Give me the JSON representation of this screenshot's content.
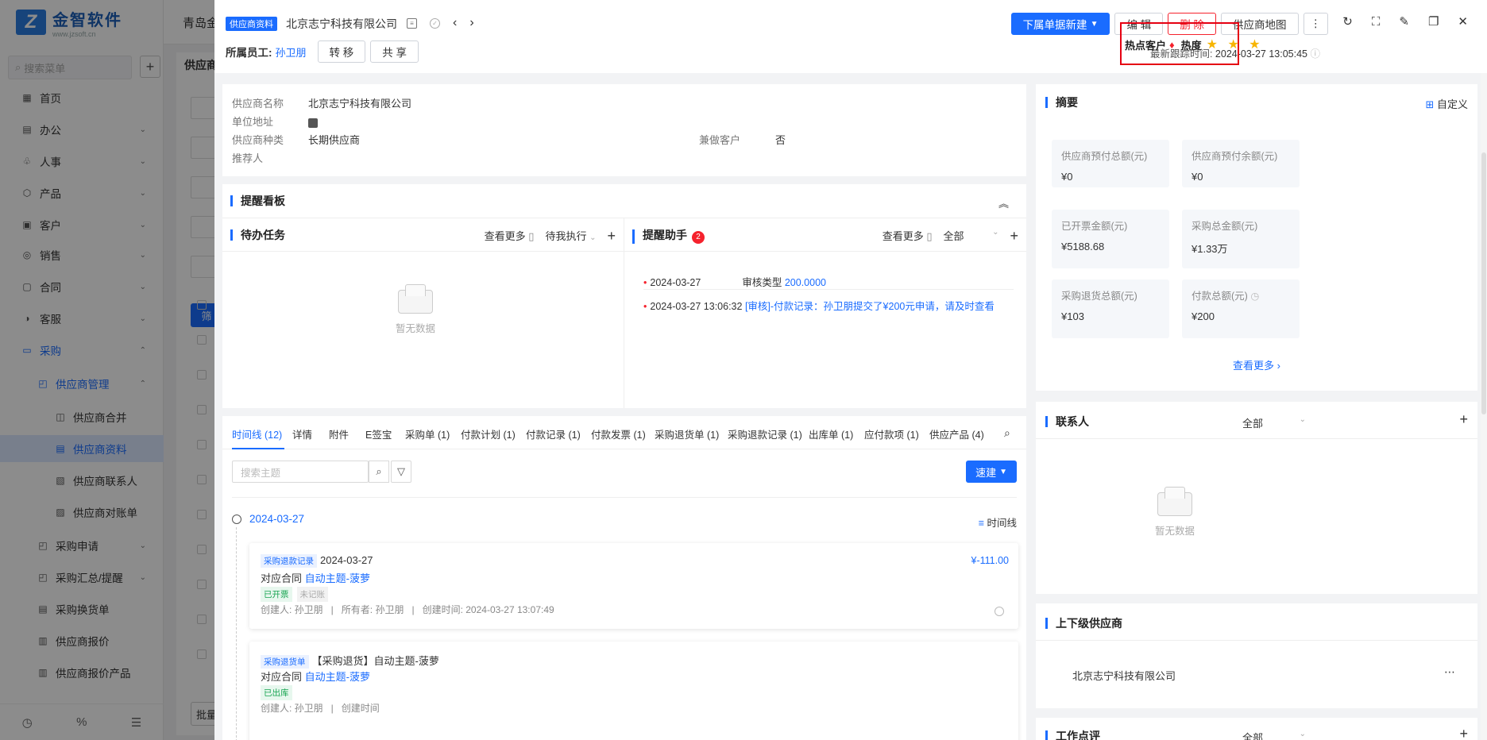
{
  "app": {
    "logo_title": "金智软件",
    "logo_sub": "www.jzsoft.cn",
    "top_title": "青岛金",
    "search_placeholder": "搜索菜单",
    "bg_tab": "供应商",
    "bg_filter_btn": "筛",
    "bg_batch_btn": "批量"
  },
  "nav": {
    "home": "首页",
    "office": "办公",
    "hr": "人事",
    "product": "产品",
    "customer": "客户",
    "sales": "销售",
    "contract": "合同",
    "service": "客服",
    "purchase": "采购",
    "supplier_mgmt": "供应商管理",
    "supplier_merge": "供应商合并",
    "supplier_info": "供应商资料",
    "supplier_contact": "供应商联系人",
    "supplier_statement": "供应商对账单",
    "purchase_apply": "采购申请",
    "purchase_summary": "采购汇总/提醒",
    "purchase_exchange": "采购换货单",
    "supplier_quote": "供应商报价",
    "supplier_quote_product": "供应商报价产品"
  },
  "drawer": {
    "tag": "供应商资料",
    "name": "北京志宁科技有限公司",
    "owner_label": "所属员工:",
    "owner_name": "孙卫朋",
    "transfer": "转 移",
    "share": "共 享",
    "new_sub": "下属单据新建",
    "edit": "编 辑",
    "delete": "删 除",
    "map": "供应商地图",
    "trace_label": "最新跟踪时间:",
    "trace_time": "2024-03-27 13:05:45",
    "hot_customer": "热点客户",
    "heat": "热度",
    "stars": "★ ★ ★"
  },
  "info": {
    "supplier_name_label": "供应商名称",
    "supplier_name": "北京志宁科技有限公司",
    "address_label": "单位地址",
    "type_label": "供应商种类",
    "type": "长期供应商",
    "also_customer_label": "兼做客户",
    "also_customer": "否",
    "referrer_label": "推荐人"
  },
  "board": {
    "title": "提醒看板",
    "todo_title": "待办任务",
    "todo_more": "查看更多",
    "todo_filter": "待我执行",
    "todo_empty": "暂无数据",
    "assist_title": "提醒助手",
    "assist_badge": "2",
    "assist_more": "查看更多",
    "assist_filter": "全部",
    "r1_date": "2024-03-27",
    "r1_label": "审核类型",
    "r1_value": "200.0000",
    "r2_date": "2024-03-27 13:06:32",
    "r2_text": "[审核]-付款记录：孙卫朋提交了¥200元申请，请及时查看"
  },
  "tabs": [
    "时间线 (12)",
    "详情",
    "附件",
    "E签宝",
    "采购单 (1)",
    "付款计划 (1)",
    "付款记录 (1)",
    "付款发票 (1)",
    "采购退货单 (1)",
    "采购退款记录 (1)",
    "出库单 (1)",
    "应付款项 (1)",
    "供应产品 (4)"
  ],
  "timeline": {
    "search_placeholder": "搜索主题",
    "quick": "速建",
    "date": "2024-03-27",
    "view": "时间线",
    "c1_tag": "采购退款记录",
    "c1_date": "2024-03-27",
    "c1_amount": "¥-111.00",
    "c1_contract_label": "对应合同",
    "c1_contract": "自动主题-菠萝",
    "c1_st1": "已开票",
    "c1_st2": "未记账",
    "c1_meta": "创建人: 孙卫朋   |   所有者: 孙卫朋   |   创建时间: 2024-03-27 13:07:49",
    "c2_tag": "采购退货单",
    "c2_title": "【采购退货】自动主题-菠萝",
    "c2_contract_label": "对应合同",
    "c2_contract": "自动主题-菠萝",
    "c2_st1": "已出库",
    "c2_meta": "创建人: 孙卫朋   |   创建时间"
  },
  "summary": {
    "title": "摘要",
    "custom": "自定义",
    "items": [
      {
        "label": "供应商预付总额(元)",
        "value": "¥0"
      },
      {
        "label": "供应商预付余额(元)",
        "value": "¥0"
      },
      {
        "label": "已开票金额(元)",
        "value": "¥5188.68"
      },
      {
        "label": "采购总金额(元)",
        "value": "¥1.33万"
      },
      {
        "label": "采购退货总额(元)",
        "value": "¥103"
      },
      {
        "label": "付款总额(元)",
        "value": "¥200"
      }
    ],
    "more": "查看更多"
  },
  "contacts": {
    "title": "联系人",
    "filter": "全部",
    "empty": "暂无数据"
  },
  "hierarchy": {
    "title": "上下级供应商",
    "item": "北京志宁科技有限公司"
  },
  "worklog": {
    "title": "工作点评",
    "filter": "全部"
  }
}
